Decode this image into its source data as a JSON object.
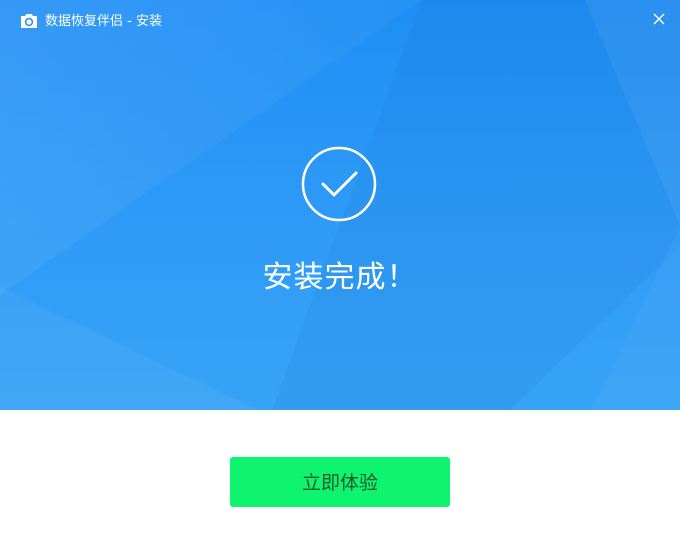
{
  "window": {
    "title": "数据恢复伴侣 - 安装"
  },
  "icons": {
    "app": "camera-icon",
    "close": "close-icon",
    "status": "check-circle-icon"
  },
  "main": {
    "status_text": "安装完成！"
  },
  "footer": {
    "primary_label": "立即体验"
  },
  "colors": {
    "hero_blue": "#1f8ef5",
    "button_green": "#0ff46f",
    "text_white": "#ffffff"
  }
}
